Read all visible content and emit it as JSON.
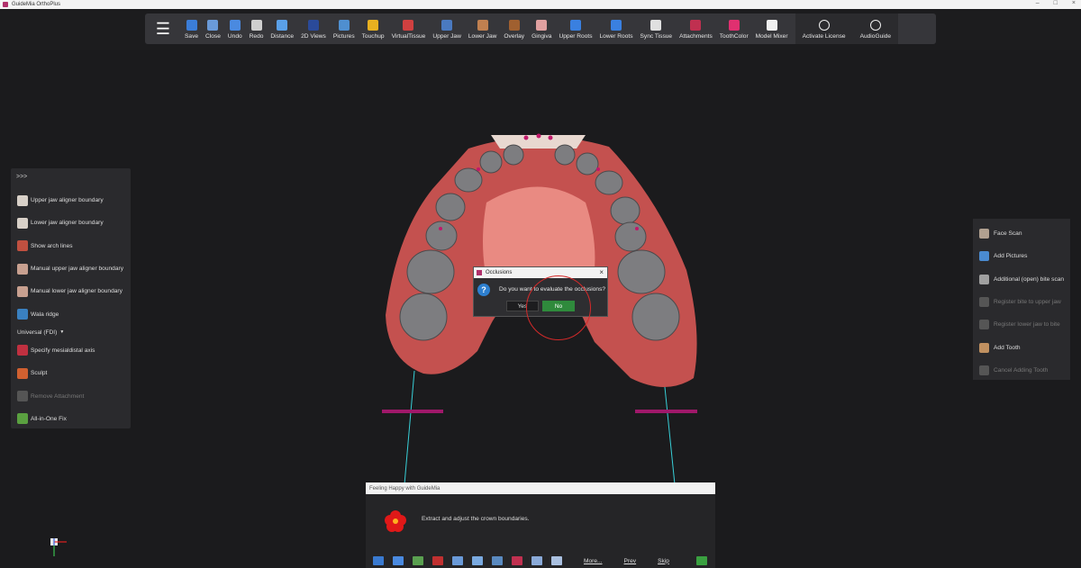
{
  "window": {
    "title": "GuideMia OrthoPlus",
    "controls": [
      "–",
      "□",
      "×"
    ]
  },
  "toolbar": {
    "menu_icon": "hamburger-icon",
    "buttons": [
      {
        "label": "Save",
        "icon": "save-icon",
        "color": "#3b7dd8"
      },
      {
        "label": "Close",
        "icon": "close-file-icon",
        "color": "#6a9ad8"
      },
      {
        "label": "Undo",
        "icon": "undo-icon",
        "color": "#4a8ae0"
      },
      {
        "label": "Redo",
        "icon": "redo-icon",
        "color": "#cfcfcf"
      },
      {
        "label": "Distance",
        "icon": "ruler-icon",
        "color": "#5aa0e8"
      },
      {
        "label": "2D Views",
        "icon": "views-2d-icon",
        "color": "#2a4a9a"
      },
      {
        "label": "Pictures",
        "icon": "pictures-icon",
        "color": "#4f8fd0"
      },
      {
        "label": "Touchup",
        "icon": "touchup-icon",
        "color": "#e8b020"
      },
      {
        "label": "VirtualTissue",
        "icon": "virtual-tissue-icon",
        "color": "#d04040"
      },
      {
        "label": "Upper Jaw",
        "icon": "upper-jaw-icon",
        "color": "#4a7ac0"
      },
      {
        "label": "Lower Jaw",
        "icon": "lower-jaw-icon",
        "color": "#c08050"
      },
      {
        "label": "Overlay",
        "icon": "overlay-icon",
        "color": "#a06030"
      },
      {
        "label": "Gingiva",
        "icon": "gingiva-icon",
        "color": "#e0a0a0"
      },
      {
        "label": "Upper Roots",
        "icon": "upper-roots-icon",
        "color": "#3a80e0"
      },
      {
        "label": "Lower Roots",
        "icon": "lower-roots-icon",
        "color": "#3a80e0"
      },
      {
        "label": "Sync Tissue",
        "icon": "sync-tissue-icon",
        "color": "#e0e0e0"
      },
      {
        "label": "Attachments",
        "icon": "attachments-icon",
        "color": "#c03050"
      },
      {
        "label": "ToothColor",
        "icon": "tooth-color-icon",
        "color": "#e03070"
      },
      {
        "label": "Model Mixer",
        "icon": "model-mixer-icon",
        "color": "#f0f0f0"
      }
    ],
    "right_buttons": [
      {
        "label": "Activate License",
        "icon": "key-icon"
      },
      {
        "label": "AudioGuide",
        "icon": "mic-off-icon"
      }
    ]
  },
  "left_panel": {
    "collapse_label": ">>>",
    "items": [
      {
        "label": "Upper jaw aligner boundary",
        "icon": "upper-boundary-icon",
        "enabled": true
      },
      {
        "label": "Lower jaw aligner boundary",
        "icon": "lower-boundary-icon",
        "enabled": true
      },
      {
        "label": "Show arch lines",
        "icon": "arch-lines-icon",
        "enabled": true
      },
      {
        "label": "Manual upper jaw aligner boundary",
        "icon": "manual-upper-icon",
        "enabled": true
      },
      {
        "label": "Manual lower jaw aligner boundary",
        "icon": "manual-lower-icon",
        "enabled": true
      },
      {
        "label": "Wala ridge",
        "icon": "wala-ridge-icon",
        "enabled": true
      }
    ],
    "numbering_select": "Universal (FDI)",
    "items2": [
      {
        "label": "Specify mesialdistal axis",
        "icon": "axis-icon",
        "enabled": true
      },
      {
        "label": "Sculpt",
        "icon": "sculpt-icon",
        "enabled": true
      },
      {
        "label": "Remove Attachment",
        "icon": "remove-attachment-icon",
        "enabled": false
      },
      {
        "label": "All-in-One Fix",
        "icon": "tools-icon",
        "enabled": true
      }
    ]
  },
  "right_panel": {
    "items": [
      {
        "label": "Face Scan",
        "icon": "face-scan-icon",
        "enabled": true
      },
      {
        "label": "Add Pictures",
        "icon": "add-pictures-icon",
        "enabled": true
      },
      {
        "label": "Additional (open) bite scan",
        "icon": "bite-scan-icon",
        "enabled": true
      },
      {
        "label": "Register bite to upper jaw",
        "icon": "register-upper-icon",
        "enabled": false
      },
      {
        "label": "Register lower jaw to bite",
        "icon": "register-lower-icon",
        "enabled": false
      },
      {
        "label": "Add Tooth",
        "icon": "add-tooth-icon",
        "enabled": true
      },
      {
        "label": "Cancel Adding Tooth",
        "icon": "cancel-tooth-icon",
        "enabled": false
      }
    ]
  },
  "dialog": {
    "title": "Occlusions",
    "close": "×",
    "message": "Do you want to evaluate the occlusions?",
    "yes_label": "Yes",
    "no_label": "No"
  },
  "helper": {
    "title": "Feeling Happy with GuideMia",
    "message": "Extract and adjust the crown boundaries.",
    "more_label": "More...",
    "prev_label": "Prev",
    "skip_label": "Skip"
  }
}
